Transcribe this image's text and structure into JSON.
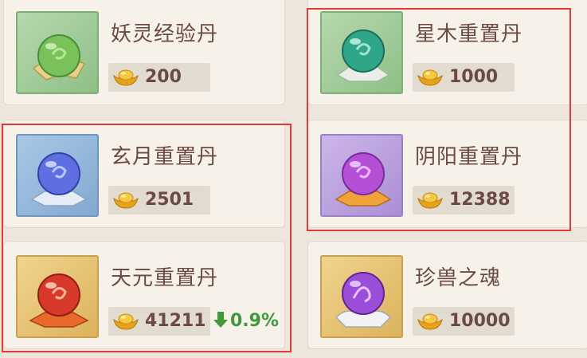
{
  "items": [
    {
      "name": "妖灵经验丹",
      "price": "200",
      "icon": "green-orb-icon",
      "frame": "green"
    },
    {
      "name": "星木重置丹",
      "price": "1000",
      "icon": "teal-orb-icon",
      "frame": "green"
    },
    {
      "name": "玄月重置丹",
      "price": "2501",
      "icon": "blue-orb-icon",
      "frame": "blue"
    },
    {
      "name": "阴阳重置丹",
      "price": "12388",
      "icon": "purple-orb-icon",
      "frame": "purple"
    },
    {
      "name": "天元重置丹",
      "price": "41211",
      "icon": "red-orb-icon",
      "frame": "gold",
      "trend": "0.9%",
      "trend_direction": "down"
    },
    {
      "name": "珍兽之魂",
      "price": "10000",
      "icon": "purple-spirit-orb-icon",
      "frame": "gold"
    }
  ],
  "currency_icon": "gold-ingot-icon",
  "colors": {
    "trend_down": "#3f9a3c",
    "highlight": "#e43a36",
    "text": "#6b4a42"
  }
}
